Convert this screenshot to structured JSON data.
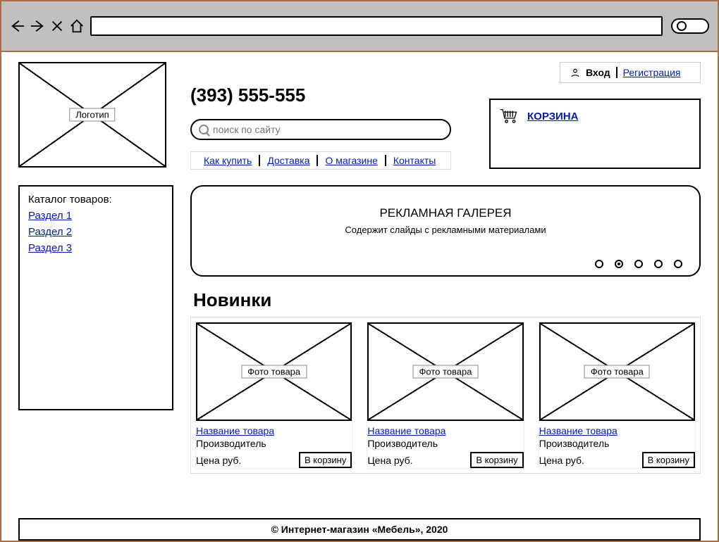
{
  "logo_label": "Логотип",
  "phone": "(393) 555-555",
  "search": {
    "placeholder": "поиск по сайту"
  },
  "info_links": [
    "Как купить",
    "Доставка",
    "О магазине",
    "Контакты"
  ],
  "auth": {
    "login": "Вход",
    "register": "Регистрация"
  },
  "cart": {
    "label": "КОРЗИНА"
  },
  "catalog": {
    "title": "Каталог товаров:",
    "sections": [
      "Раздел 1",
      "Раздел 2",
      "Раздел 3"
    ]
  },
  "gallery": {
    "title": "РЕКЛАМНАЯ ГАЛЕРЕЯ",
    "subtitle": "Содержит слайды с рекламными материалами",
    "dot_count": 5,
    "active_dot": 1
  },
  "new_items_heading": "Новинки",
  "products": [
    {
      "photo_label": "Фото товара",
      "name": "Название товара",
      "maker": "Производитель",
      "price": "Цена руб.",
      "add": "В корзину"
    },
    {
      "photo_label": "Фото товара",
      "name": "Название товара",
      "maker": "Производитель",
      "price": "Цена руб.",
      "add": "В корзину"
    },
    {
      "photo_label": "Фото товара",
      "name": "Название товара",
      "maker": "Производитель",
      "price": "Цена руб.",
      "add": "В корзину"
    }
  ],
  "footer": "© Интернет-магазин «Мебель», 2020"
}
